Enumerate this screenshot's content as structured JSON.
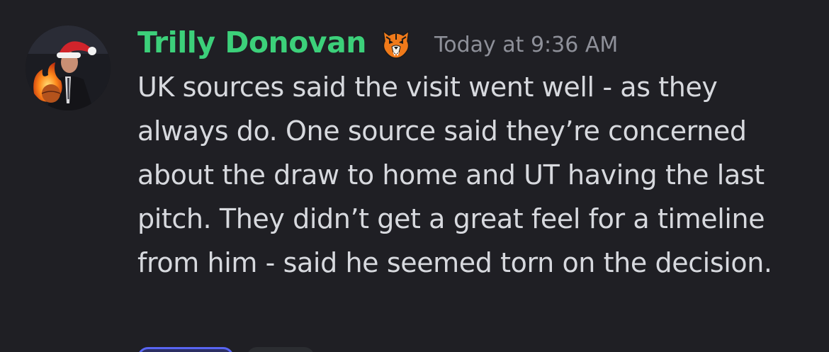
{
  "message": {
    "author": "Trilly Donovan",
    "role_icon": "tiger-head-icon",
    "timestamp": "Today at 9:36 AM",
    "text": "UK sources said the visit went well - as they always do. One source said they’re concerned about the draw to home and UT having the last pitch. They didn’t get a great feel for a timeline from him - said he seemed torn on the decision."
  },
  "colors": {
    "background": "#1f1f24",
    "author": "#3cd07a",
    "timestamp": "#8e9099",
    "text": "#d7d9de",
    "reaction_active_border": "#5865f2"
  }
}
